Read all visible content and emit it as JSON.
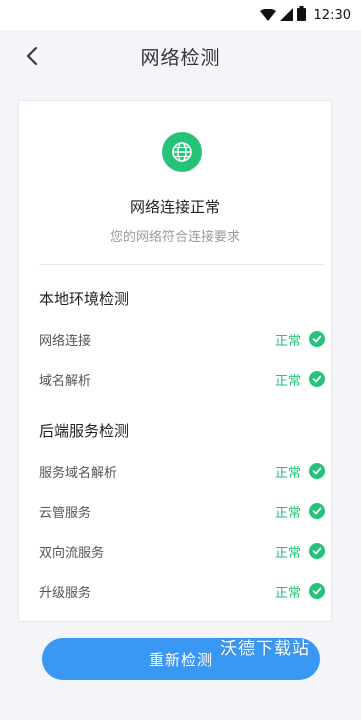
{
  "status_bar": {
    "time": "12:30",
    "icons": [
      "wifi-icon",
      "signal-icon",
      "battery-icon"
    ]
  },
  "header": {
    "title": "网络检测",
    "back_icon": "chevron-left-icon"
  },
  "summary": {
    "icon": "globe-icon",
    "title": "网络连接正常",
    "subtitle": "您的网络符合连接要求"
  },
  "sections": [
    {
      "title": "本地环境检测",
      "items": [
        {
          "label": "网络连接",
          "status": "正常"
        },
        {
          "label": "域名解析",
          "status": "正常"
        }
      ]
    },
    {
      "title": "后端服务检测",
      "items": [
        {
          "label": "服务域名解析",
          "status": "正常"
        },
        {
          "label": "云管服务",
          "status": "正常"
        },
        {
          "label": "双向流服务",
          "status": "正常"
        },
        {
          "label": "升级服务",
          "status": "正常"
        }
      ]
    }
  ],
  "retest_button": {
    "label": "重新检测"
  },
  "watermark": "沃德下载站",
  "colors": {
    "accent_green": "#27c27a",
    "button_blue": "#3a98f2",
    "background": "#f4f5f8"
  }
}
